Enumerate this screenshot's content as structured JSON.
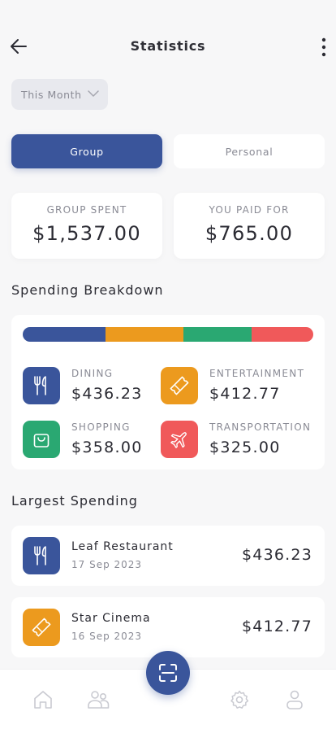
{
  "header": {
    "title": "Statistics"
  },
  "period": {
    "selected": "This Month"
  },
  "tabs": {
    "group": "Group",
    "personal": "Personal"
  },
  "summary": {
    "group_label": "GROUP SPENT",
    "group_value": "$1,537.00",
    "paid_label": "YOU PAID FOR",
    "paid_value": "$765.00"
  },
  "breakdown": {
    "title": "Spending Breakdown",
    "categories": [
      {
        "name": "DINING",
        "amount": "$436.23",
        "value": 436.23,
        "color": "#3a559b",
        "icon": "cutlery-icon"
      },
      {
        "name": "ENTERTAINMENT",
        "amount": "$412.77",
        "value": 412.77,
        "color": "#ec9a1e",
        "icon": "ticket-icon"
      },
      {
        "name": "SHOPPING",
        "amount": "$358.00",
        "value": 358.0,
        "color": "#2aa872",
        "icon": "shopping-bag-icon"
      },
      {
        "name": "TRANSPORTATION",
        "amount": "$325.00",
        "value": 325.0,
        "color": "#f0595a",
        "icon": "airplane-icon"
      }
    ]
  },
  "largest": {
    "title": "Largest Spending",
    "items": [
      {
        "name": "Leaf Restaurant",
        "date": "17 Sep 2023",
        "amount": "$436.23",
        "color": "#3a559b",
        "icon": "cutlery-icon"
      },
      {
        "name": "Star Cinema",
        "date": "16 Sep 2023",
        "amount": "$412.77",
        "color": "#ec9a1e",
        "icon": "ticket-icon"
      }
    ]
  },
  "nav": {
    "icons": [
      "home-icon",
      "friends-icon",
      "scan-icon",
      "settings-icon",
      "profile-icon"
    ]
  }
}
